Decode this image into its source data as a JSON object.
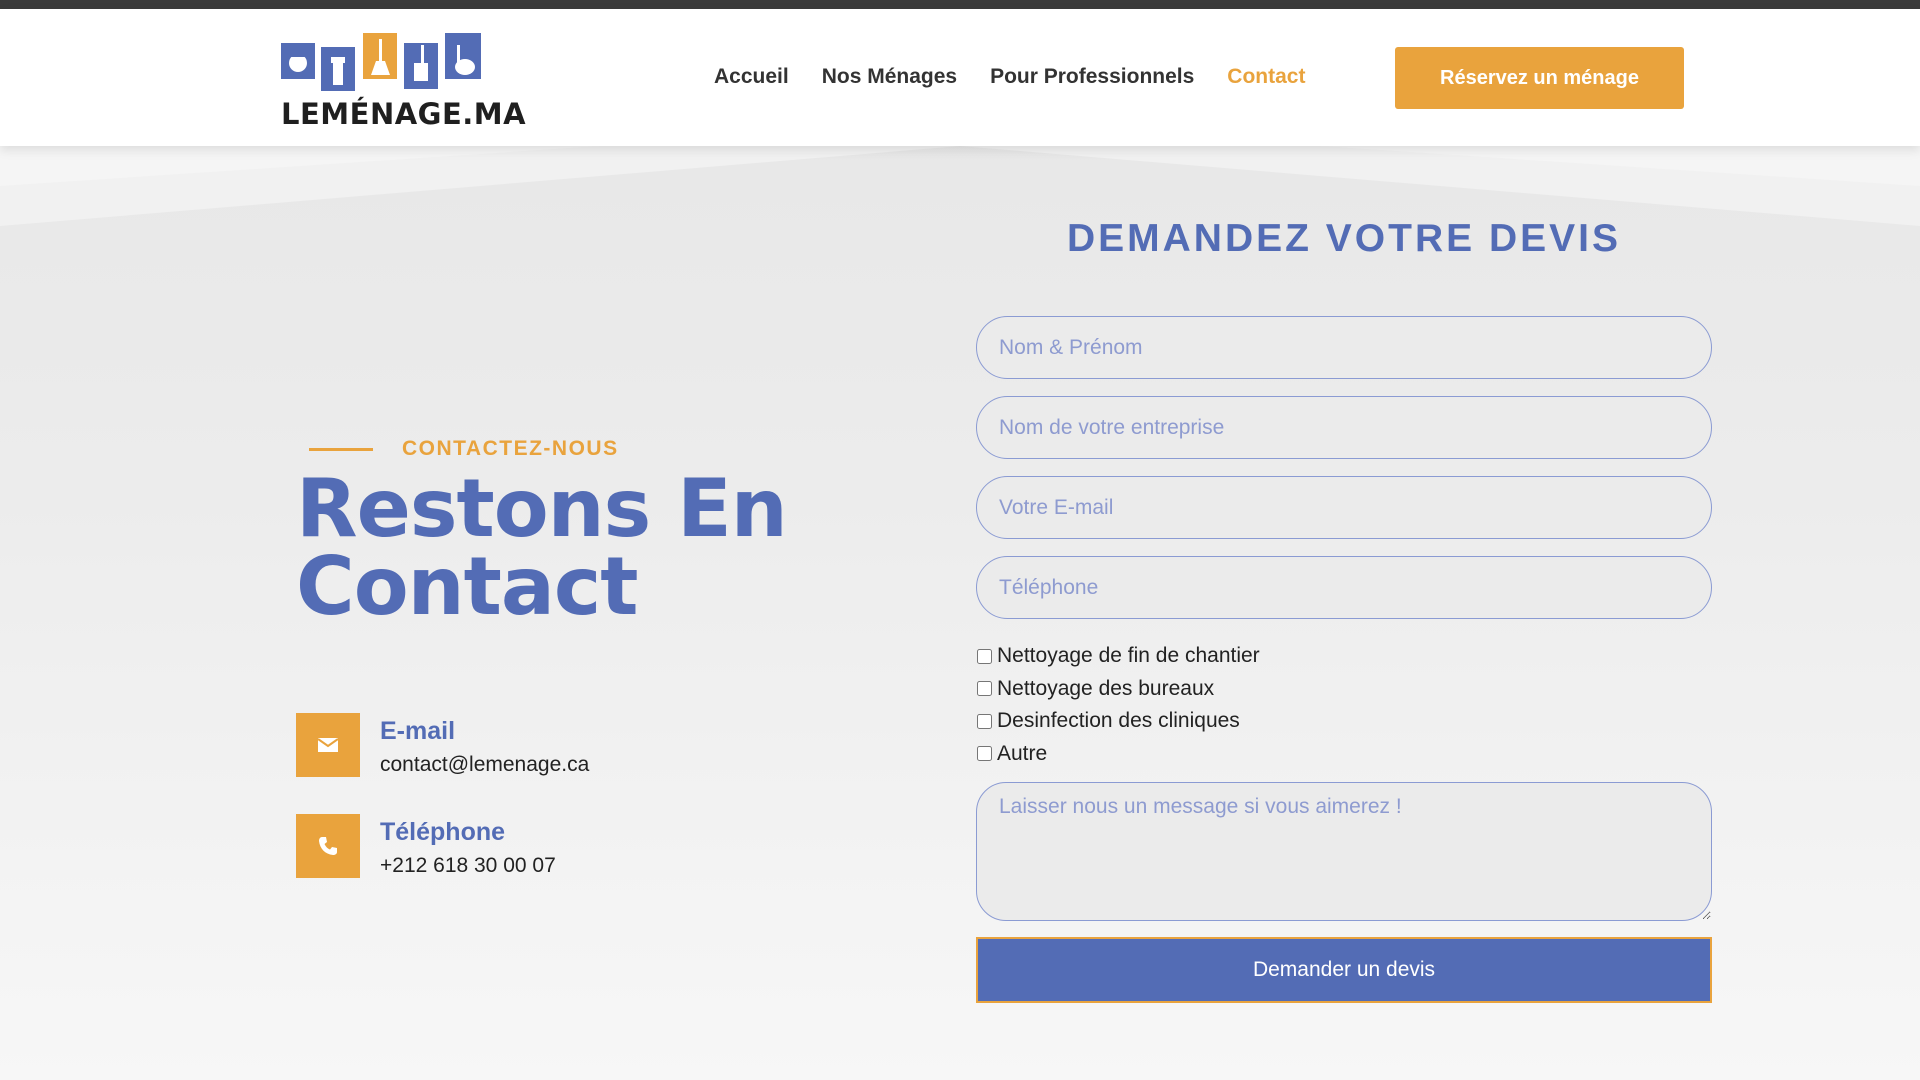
{
  "brand": {
    "name": "LEMÉNAGE.MA",
    "colors": {
      "accent": "#e9a33d",
      "primary": "#536cb5",
      "topbar": "#3b3b3b"
    }
  },
  "nav": {
    "items": [
      {
        "label": "Accueil",
        "active": false
      },
      {
        "label": "Nos Ménages",
        "active": false
      },
      {
        "label": "Pour Professionnels",
        "active": false
      },
      {
        "label": "Contact",
        "active": true
      }
    ],
    "cta_label": "Réservez un ménage"
  },
  "contact": {
    "kicker": "CONTACTEZ-NOUS",
    "title": "Restons En Contact",
    "email": {
      "icon": "envelope-icon",
      "title": "E-mail",
      "value": "contact@lemenage.ca"
    },
    "phone": {
      "icon": "phone-icon",
      "title": "Téléphone",
      "value": "+212 618 30 00 07"
    }
  },
  "form": {
    "title": "DEMANDEZ VOTRE DEVIS",
    "fields": {
      "name_placeholder": "Nom & Prénom",
      "company_placeholder": "Nom de votre entreprise",
      "email_placeholder": "Votre E-mail",
      "phone_placeholder": "Téléphone",
      "message_placeholder": "Laisser nous un message si vous aimerez !"
    },
    "options": [
      {
        "label": "Nettoyage de fin de chantier",
        "checked": false
      },
      {
        "label": "Nettoyage des bureaux",
        "checked": false
      },
      {
        "label": "Desinfection des cliniques",
        "checked": false
      },
      {
        "label": "Autre",
        "checked": false
      }
    ],
    "submit_label": "Demander un devis"
  }
}
